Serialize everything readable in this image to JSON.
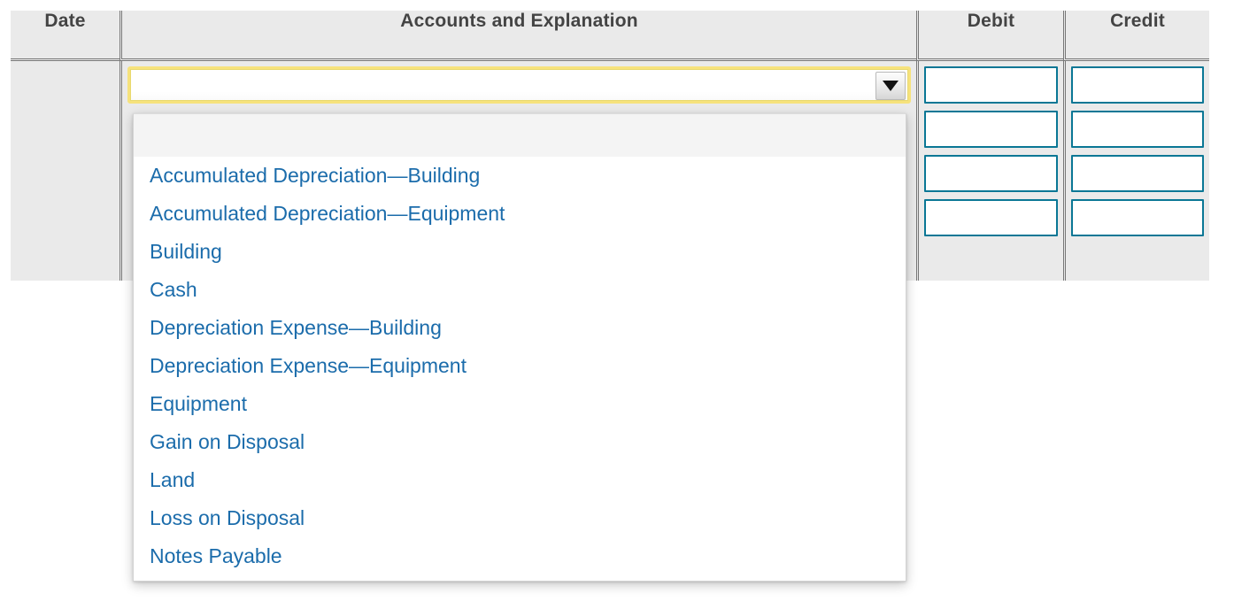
{
  "table": {
    "headers": {
      "date": "Date",
      "accounts": "Accounts and Explanation",
      "debit": "Debit",
      "credit": "Credit"
    },
    "date_cell_value": ""
  },
  "account_select": {
    "selected_value": "",
    "arrow_icon": "chevron-down-icon",
    "is_open": true,
    "focus_ring_color": "#f6e27c",
    "options": [
      "",
      "Accumulated Depreciation—Building",
      "Accumulated Depreciation—Equipment",
      "Building",
      "Cash",
      "Depreciation Expense—Building",
      "Depreciation Expense—Equipment",
      "Equipment",
      "Gain on Disposal",
      "Land",
      "Loss on Disposal",
      "Notes Payable"
    ]
  },
  "debit_inputs": [
    {
      "value": "",
      "placeholder": ""
    },
    {
      "value": "",
      "placeholder": ""
    },
    {
      "value": "",
      "placeholder": ""
    },
    {
      "value": "",
      "placeholder": ""
    }
  ],
  "credit_inputs": [
    {
      "value": "",
      "placeholder": ""
    },
    {
      "value": "",
      "placeholder": ""
    },
    {
      "value": "",
      "placeholder": ""
    },
    {
      "value": "",
      "placeholder": ""
    }
  ],
  "colors": {
    "header_bg": "#eaeaea",
    "header_text": "#444444",
    "border": "#777777",
    "option_text": "#1b6cab",
    "input_border": "#0a7795",
    "focus_ring": "#f6e27c",
    "blank_option_bg": "#f4f4f4"
  }
}
